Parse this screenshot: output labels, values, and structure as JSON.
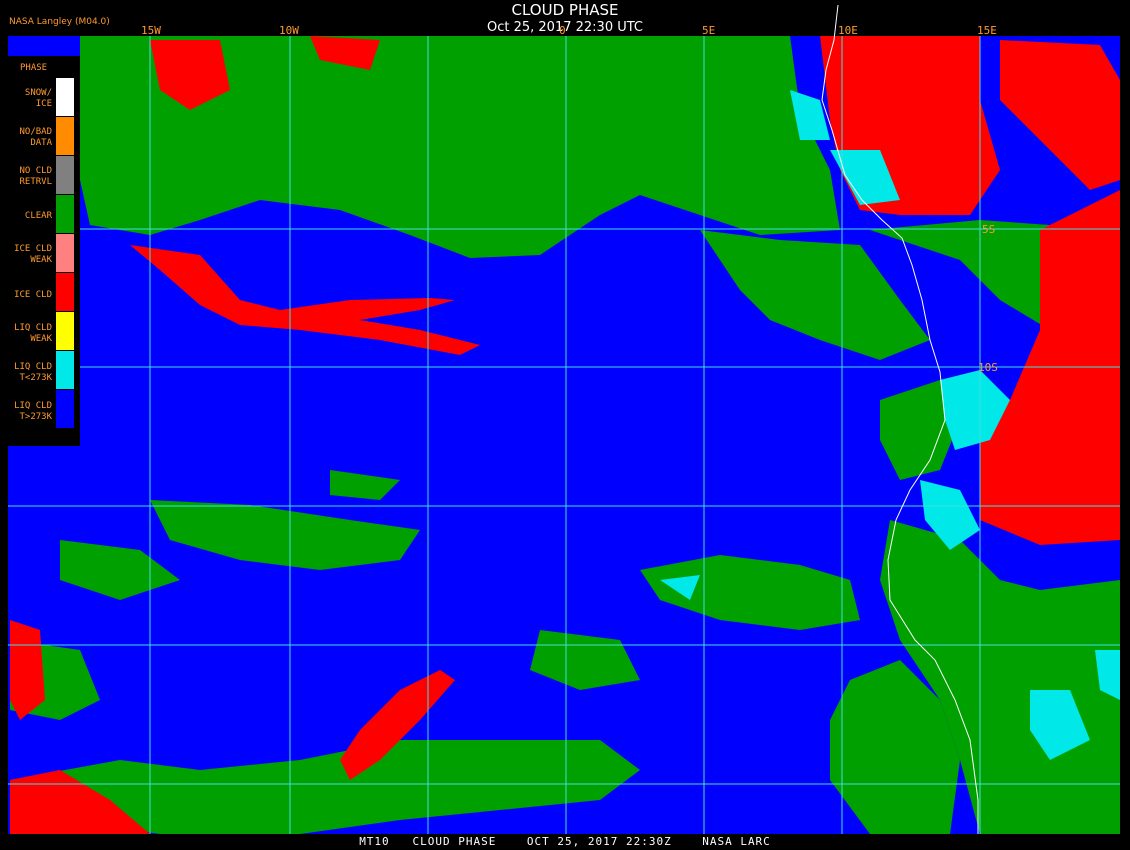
{
  "header": {
    "title": "CLOUD PHASE",
    "subtitle": "Oct 25, 2017 22:30 UTC",
    "provider": "NASA Langley (M04.0)"
  },
  "lon_labels": [
    "15W",
    "10W",
    "0",
    "5E",
    "10E",
    "15E"
  ],
  "lat_labels": [
    "5S",
    "10S"
  ],
  "legend": {
    "title": "PHASE",
    "items": [
      {
        "label": "SNOW/\nICE",
        "color": "#ffffff"
      },
      {
        "label": "NO/BAD\nDATA",
        "color": "#ff8c00"
      },
      {
        "label": "NO CLD\nRETRVL",
        "color": "#808080"
      },
      {
        "label": "CLEAR",
        "color": "#00a000"
      },
      {
        "label": "ICE CLD\nWEAK",
        "color": "#ff8080"
      },
      {
        "label": "ICE CLD",
        "color": "#ff0000"
      },
      {
        "label": "LIQ CLD\nWEAK",
        "color": "#ffff00"
      },
      {
        "label": "LIQ CLD\nT<273K",
        "color": "#00e8e8"
      },
      {
        "label": "LIQ CLD\nT>273K",
        "color": "#0000ff"
      }
    ]
  },
  "footer": "MT10   CLOUD PHASE    OCT 25, 2017 22:30Z    NASA LARC",
  "colors": {
    "ocean_liquid": "#0000ff",
    "clear": "#00a000",
    "ice": "#ff0000",
    "liquid_cold": "#00e8e8",
    "grid": "#40e0e0",
    "coast": "#ffffff",
    "label": "#ff9a2e"
  }
}
